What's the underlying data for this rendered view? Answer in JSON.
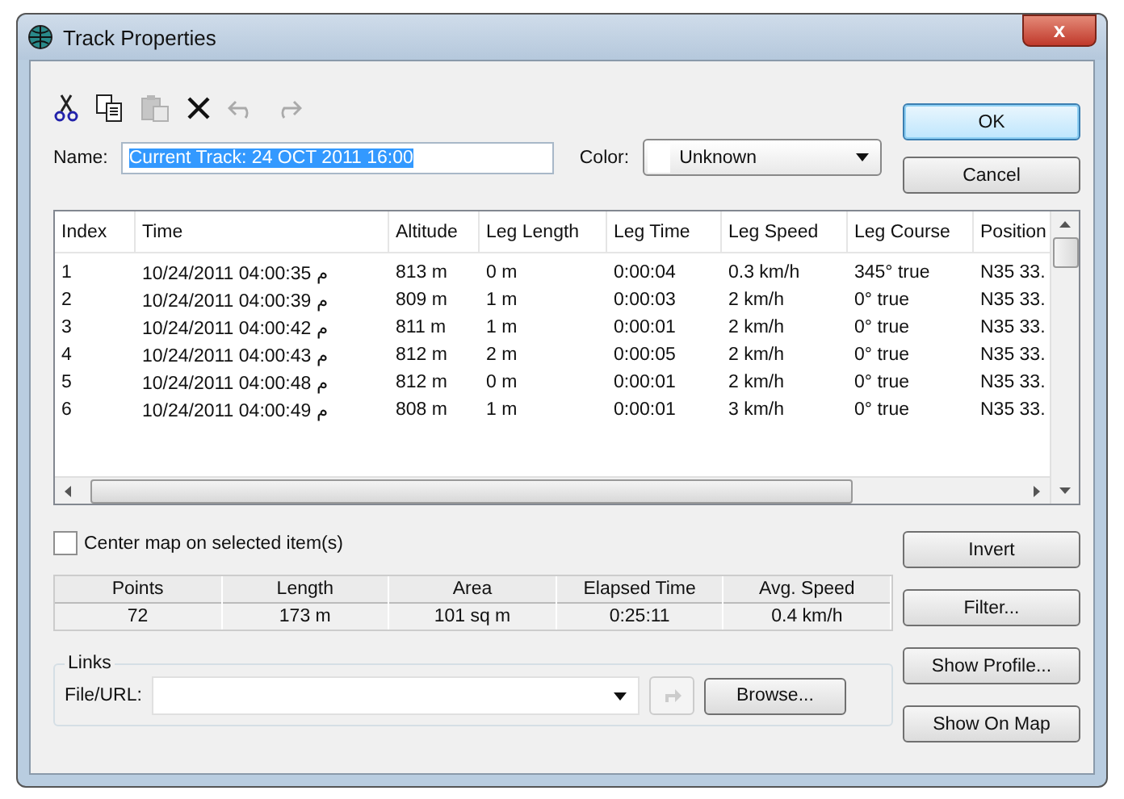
{
  "window": {
    "title": "Track Properties"
  },
  "toolbar": [
    {
      "kind": "cut",
      "disabled": false
    },
    {
      "kind": "copy",
      "disabled": false
    },
    {
      "kind": "paste",
      "disabled": true
    },
    {
      "kind": "delete",
      "disabled": false
    },
    {
      "kind": "undo",
      "disabled": true
    },
    {
      "kind": "redo",
      "disabled": true
    }
  ],
  "name": {
    "label": "Name:",
    "value": "Current Track: 24 OCT 2011 16:00"
  },
  "color": {
    "label": "Color:",
    "value": "Unknown"
  },
  "table": {
    "columns": [
      "Index",
      "Time",
      "Altitude",
      "Leg Length",
      "Leg Time",
      "Leg Speed",
      "Leg Course",
      "Position"
    ],
    "rows": [
      [
        "1",
        "10/24/2011 04:00:35 م",
        "813 m",
        "0 m",
        "0:00:04",
        "0.3 km/h",
        "345° true",
        "N35 33."
      ],
      [
        "2",
        "10/24/2011 04:00:39 م",
        "809 m",
        "1 m",
        "0:00:03",
        "2 km/h",
        "0° true",
        "N35 33."
      ],
      [
        "3",
        "10/24/2011 04:00:42 م",
        "811 m",
        "1 m",
        "0:00:01",
        "2 km/h",
        "0° true",
        "N35 33."
      ],
      [
        "4",
        "10/24/2011 04:00:43 م",
        "812 m",
        "2 m",
        "0:00:05",
        "2 km/h",
        "0° true",
        "N35 33."
      ],
      [
        "5",
        "10/24/2011 04:00:48 م",
        "812 m",
        "0 m",
        "0:00:01",
        "2 km/h",
        "0° true",
        "N35 33."
      ],
      [
        "6",
        "10/24/2011 04:00:49 م",
        "808 m",
        "1 m",
        "0:00:01",
        "3 km/h",
        "0° true",
        "N35 33."
      ]
    ]
  },
  "center_map": {
    "label": "Center map on selected item(s)",
    "checked": false
  },
  "stats": [
    {
      "label": "Points",
      "value": "72"
    },
    {
      "label": "Length",
      "value": "173 m"
    },
    {
      "label": "Area",
      "value": "101 sq m"
    },
    {
      "label": "Elapsed Time",
      "value": "0:25:11"
    },
    {
      "label": "Avg. Speed",
      "value": "0.4 km/h"
    }
  ],
  "links": {
    "title": "Links",
    "label": "File/URL:",
    "browse": "Browse..."
  },
  "buttons": {
    "ok": "OK",
    "cancel": "Cancel",
    "side": [
      "Invert",
      "Filter...",
      "Show Profile...",
      "Show On Map"
    ]
  },
  "close": "x"
}
